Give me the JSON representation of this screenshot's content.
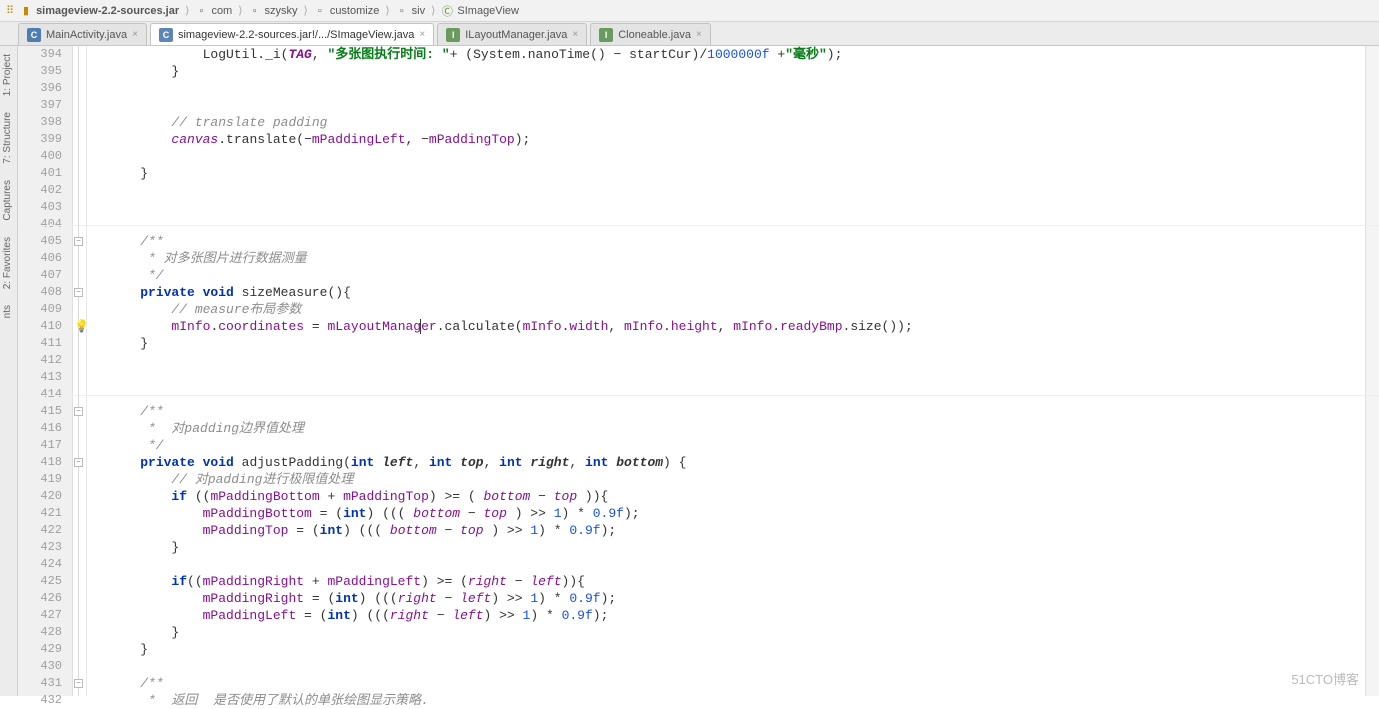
{
  "breadcrumb": [
    {
      "icon": "lib",
      "label": "simageview-2.2-sources.jar"
    },
    {
      "icon": "pkg",
      "label": "com"
    },
    {
      "icon": "pkg",
      "label": "szysky"
    },
    {
      "icon": "pkg",
      "label": "customize"
    },
    {
      "icon": "pkg",
      "label": "siv"
    },
    {
      "icon": "cls",
      "label": "SImageView"
    }
  ],
  "tabs": [
    {
      "icon": "c",
      "label": "MainActivity.java",
      "close": "×",
      "active": false
    },
    {
      "icon": "c08",
      "label": "simageview-2.2-sources.jar!/.../SImageView.java",
      "close": "×",
      "active": true
    },
    {
      "icon": "io",
      "label": "ILayoutManager.java",
      "close": "×",
      "active": false
    },
    {
      "icon": "i",
      "label": "Cloneable.java",
      "close": "×",
      "active": false
    }
  ],
  "side_left": [
    {
      "label": "1: Project"
    },
    {
      "label": "7: Structure"
    },
    {
      "label": "Captures"
    },
    {
      "label": "2: Favorites"
    },
    {
      "label": "nts"
    }
  ],
  "lines": {
    "start": 394,
    "end": 432
  },
  "bulb_line": 410,
  "cursor_line": 410,
  "code_rows": [
    {
      "n": 394,
      "cls": "code1",
      "html": "            LogUtil.<span class='method'>_i</span>(<span class='staticf'>TAG</span>, <span class='str'>\"多张图执行时间: \"</span>+ (System.<span class='method'>nanoTime</span>() − startCur)/<span class='num'>1000000f</span> +<span class='str'>\"毫秒\"</span>);"
    },
    {
      "n": 395,
      "html": "        }"
    },
    {
      "n": 396,
      "html": ""
    },
    {
      "n": 397,
      "html": ""
    },
    {
      "n": 398,
      "html": "        <span class='cmt'>// translate padding</span>"
    },
    {
      "n": 399,
      "html": "        <span class='ident'>canvas</span>.<span class='method'>translate</span>(−<span class='field'>mPaddingLeft</span>, −<span class='field'>mPaddingTop</span>);"
    },
    {
      "n": 400,
      "html": ""
    },
    {
      "n": 401,
      "html": "    }"
    },
    {
      "n": 402,
      "html": ""
    },
    {
      "n": 403,
      "html": ""
    },
    {
      "n": 404,
      "html": ""
    },
    {
      "n": 405,
      "html": "    <span class='cmt-doc'>/**</span>"
    },
    {
      "n": 406,
      "html": "<span class='cmt-doc'>     * 对多张图片进行数据测量</span>"
    },
    {
      "n": 407,
      "html": "<span class='cmt-doc'>     */</span>"
    },
    {
      "n": 408,
      "html": "    <span class='kw'>private void</span> <span class='method'>sizeMeasure</span>(){"
    },
    {
      "n": 409,
      "html": "        <span class='cmt'>// measure布局参数</span>"
    },
    {
      "n": 410,
      "html": "        <span class='field'>mInfo</span>.<span class='field'>coordinates</span> = <span class='field'>mLayoutManag<span class='cursor-caret'></span>er</span>.<span class='method'>calculate</span>(<span class='field'>mInfo</span>.<span class='field'>width</span>, <span class='field'>mInfo</span>.<span class='field'>height</span>, <span class='field'>mInfo</span>.<span class='field'>readyBmp</span>.<span class='method'>size</span>());"
    },
    {
      "n": 411,
      "html": "    }"
    },
    {
      "n": 412,
      "html": ""
    },
    {
      "n": 413,
      "html": ""
    },
    {
      "n": 414,
      "html": ""
    },
    {
      "n": 415,
      "html": "    <span class='cmt-doc'>/**</span>"
    },
    {
      "n": 416,
      "html": "<span class='cmt-doc'>     *  对padding边界值处理</span>"
    },
    {
      "n": 417,
      "html": "<span class='cmt-doc'>     */</span>"
    },
    {
      "n": 418,
      "html": "    <span class='kw'>private void</span> <span class='method'>adjustPadding</span>(<span class='kw'>int</span> <span class='paramdecl'>left</span>, <span class='kw'>int</span> <span class='paramdecl'>top</span>, <span class='kw'>int</span> <span class='paramdecl'>right</span>, <span class='kw'>int</span> <span class='paramdecl'>bottom</span>) {"
    },
    {
      "n": 419,
      "html": "        <span class='cmt'>// 对padding进行极限值处理</span>"
    },
    {
      "n": 420,
      "html": "        <span class='kw'>if</span> ((<span class='field'>mPaddingBottom</span> + <span class='field'>mPaddingTop</span>) >= ( <span class='ident'>bottom</span> − <span class='ident'>top</span> )){"
    },
    {
      "n": 421,
      "html": "            <span class='field'>mPaddingBottom</span> = (<span class='kw'>int</span>) ((( <span class='ident'>bottom</span> − <span class='ident'>top</span> ) >> <span class='num'>1</span>) * <span class='num'>0.9f</span>);"
    },
    {
      "n": 422,
      "html": "            <span class='field'>mPaddingTop</span> = (<span class='kw'>int</span>) ((( <span class='ident'>bottom</span> − <span class='ident'>top</span> ) >> <span class='num'>1</span>) * <span class='num'>0.9f</span>);"
    },
    {
      "n": 423,
      "html": "        }"
    },
    {
      "n": 424,
      "html": ""
    },
    {
      "n": 425,
      "html": "        <span class='kw'>if</span>((<span class='field'>mPaddingRight</span> + <span class='field'>mPaddingLeft</span>) >= (<span class='ident'>right</span> − <span class='ident'>left</span>)){"
    },
    {
      "n": 426,
      "html": "            <span class='field'>mPaddingRight</span> = (<span class='kw'>int</span>) (((<span class='ident'>right</span> − <span class='ident'>left</span>) >> <span class='num'>1</span>) * <span class='num'>0.9f</span>);"
    },
    {
      "n": 427,
      "html": "            <span class='field'>mPaddingLeft</span> = (<span class='kw'>int</span>) (((<span class='ident'>right</span> − <span class='ident'>left</span>) >> <span class='num'>1</span>) * <span class='num'>0.9f</span>);"
    },
    {
      "n": 428,
      "html": "        }"
    },
    {
      "n": 429,
      "html": "    }"
    },
    {
      "n": 430,
      "html": ""
    },
    {
      "n": 431,
      "html": "    <span class='cmt-doc'>/**</span>"
    },
    {
      "n": 432,
      "html": "<span class='cmt-doc'>     *  返回  是否使用了默认的单张绘图显示策略.</span>"
    }
  ],
  "watermark": "51CTO博客"
}
